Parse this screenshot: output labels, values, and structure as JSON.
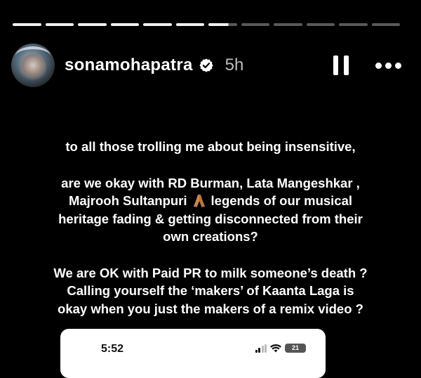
{
  "story": {
    "progress_segments": 12,
    "progress_done": 6,
    "progress_current_fraction": 0.7
  },
  "header": {
    "username": "sonamohapatra",
    "timestamp": "5h",
    "verified_icon": "verified-badge-icon",
    "pause_icon": "pause-icon",
    "more_icon": "more-options-icon"
  },
  "caption": {
    "line1": "to all those trolling me about being insensitive,",
    "line2": "are we okay with RD Burman, Lata Mangeshkar ,",
    "line3a": "Majrooh Sultanpuri",
    "line3b": "legends  of our musical",
    "line4": "heritage fading & getting disconnected from their",
    "line5": "own creations?",
    "line6": "We are OK with  Paid PR to milk someone’s death ?",
    "line7": "Calling yourself the ‘makers’ of Kaanta Laga is",
    "line8": "okay when you just the makers of a remix video  ?"
  },
  "embedded_screenshot": {
    "clock": "5:52",
    "battery": "21"
  },
  "colors": {
    "background": "#000000",
    "text": "#ffffff",
    "timestamp": "#bdbdbd"
  }
}
